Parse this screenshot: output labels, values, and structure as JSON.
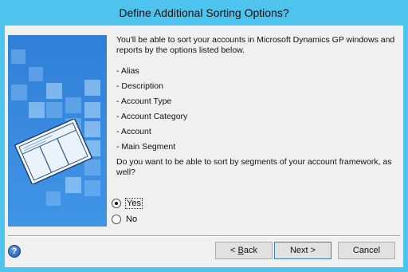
{
  "window": {
    "title": "Define Additional Sorting Options?"
  },
  "intro_text": "You'll be able to sort your accounts in Microsoft Dynamics GP windows and reports by the options listed below.",
  "options": [
    "- Alias",
    "- Description",
    "- Account Type",
    "- Account Category",
    "- Account",
    "- Main Segment"
  ],
  "question": "Do you want to be able to sort by segments of your account framework, as well?",
  "radios": [
    {
      "label": "Yes",
      "checked": true
    },
    {
      "label": "No",
      "checked": false
    }
  ],
  "buttons": {
    "back_prefix": "< ",
    "back_mnemonic": "B",
    "back_rest": "ack",
    "next": "Next >",
    "cancel": "Cancel"
  },
  "help_glyph": "?",
  "colors": {
    "titlebar": "#4ec3ee",
    "side_panel": "#2f7fd6",
    "default_border": "#3c7fb1"
  },
  "icons": {
    "help": "help-circle-icon",
    "illustration": "framework-document-illustration"
  }
}
